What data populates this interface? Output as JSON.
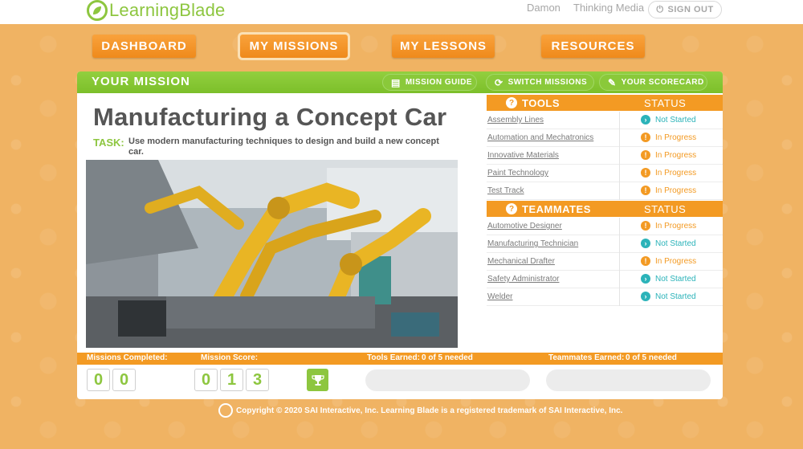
{
  "app": {
    "name": "LearningBlade"
  },
  "top": {
    "user": "Damon",
    "org": "Thinking Media",
    "signout": "SIGN OUT"
  },
  "nav": [
    "DASHBOARD",
    "MY MISSIONS",
    "MY LESSONS",
    "RESOURCES"
  ],
  "panel": {
    "header": "YOUR MISSION",
    "buttons": [
      "MISSION GUIDE",
      "SWITCH MISSIONS",
      "YOUR SCORECARD"
    ],
    "title": "Manufacturing a Concept Car",
    "task_label": "TASK:",
    "task_text": "Use modern manufacturing techniques to design and build a new concept car."
  },
  "tools": {
    "header": "TOOLS",
    "status_header": "STATUS",
    "items": [
      {
        "name": "Assembly Lines",
        "status": "Not Started"
      },
      {
        "name": "Automation and Mechatronics",
        "status": "In Progress"
      },
      {
        "name": "Innovative Materials",
        "status": "In Progress"
      },
      {
        "name": "Paint Technology",
        "status": "In Progress"
      },
      {
        "name": "Test Track",
        "status": "In Progress"
      }
    ]
  },
  "teammates": {
    "header": "TEAMMATES",
    "status_header": "STATUS",
    "items": [
      {
        "name": "Automotive Designer",
        "status": "In Progress"
      },
      {
        "name": "Manufacturing Technician",
        "status": "Not Started"
      },
      {
        "name": "Mechanical Drafter",
        "status": "In Progress"
      },
      {
        "name": "Safety Administrator",
        "status": "Not Started"
      },
      {
        "name": "Welder",
        "status": "Not Started"
      }
    ]
  },
  "stats": {
    "missions_completed_label": "Missions Completed:",
    "missions_completed_digits": [
      "0",
      "0"
    ],
    "mission_score_label": "Mission Score:",
    "mission_score_digits": [
      "0",
      "1",
      "3"
    ],
    "tools_earned_label": "Tools Earned:",
    "tools_earned_value": "0 of 5 needed",
    "teammates_earned_label": "Teammates Earned:",
    "teammates_earned_value": "0 of 5 needed"
  },
  "footer": {
    "copyright": "Copyright © 2020 SAI Interactive, Inc. Learning Blade is a registered trademark of SAI Interactive, Inc."
  },
  "colors": {
    "green": "#8dc63f",
    "orange": "#f39a23",
    "teal": "#2bb3b9",
    "background": "#f0b363"
  },
  "icons": [
    "leaf-logo-icon",
    "power-icon",
    "mission-guide-icon",
    "switch-icon",
    "scorecard-icon",
    "help-icon",
    "status-icon",
    "trophy-icon"
  ]
}
